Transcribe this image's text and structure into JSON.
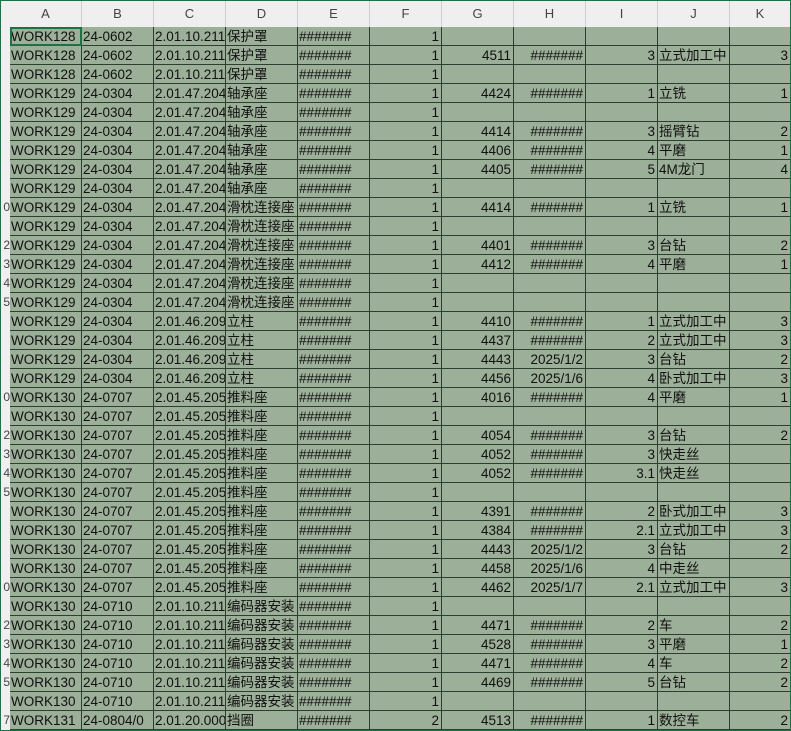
{
  "columns": [
    "A",
    "B",
    "C",
    "D",
    "E",
    "F",
    "G",
    "H",
    "I",
    "J",
    "K"
  ],
  "row_numbers": [
    "",
    "",
    "",
    "",
    "",
    "",
    "",
    "",
    "",
    "0",
    "",
    "2",
    "3",
    "4",
    "5",
    "",
    "",
    "",
    "",
    "0",
    "",
    "2",
    "3",
    "4",
    "5",
    "",
    "",
    "",
    "",
    "0",
    "",
    "2",
    "3",
    "4",
    "5",
    "",
    "7"
  ],
  "rows": [
    [
      "WORK128",
      "24-0602",
      "2.01.10.211",
      "保护罩",
      "#######",
      "1",
      "",
      "",
      "",
      "",
      ""
    ],
    [
      "WORK128",
      "24-0602",
      "2.01.10.211",
      "保护罩",
      "#######",
      "1",
      "4511",
      "#######",
      "3",
      "立式加工中",
      "3"
    ],
    [
      "WORK128",
      "24-0602",
      "2.01.10.211",
      "保护罩",
      "#######",
      "1",
      "",
      "",
      "",
      "",
      ""
    ],
    [
      "WORK129",
      "24-0304",
      "2.01.47.204",
      "轴承座",
      "#######",
      "1",
      "4424",
      "#######",
      "1",
      "立铣",
      "1"
    ],
    [
      "WORK129",
      "24-0304",
      "2.01.47.204",
      "轴承座",
      "#######",
      "1",
      "",
      "",
      "",
      "",
      ""
    ],
    [
      "WORK129",
      "24-0304",
      "2.01.47.204",
      "轴承座",
      "#######",
      "1",
      "4414",
      "#######",
      "3",
      "摇臂钻",
      "2"
    ],
    [
      "WORK129",
      "24-0304",
      "2.01.47.204",
      "轴承座",
      "#######",
      "1",
      "4406",
      "#######",
      "4",
      "平磨",
      "1"
    ],
    [
      "WORK129",
      "24-0304",
      "2.01.47.204",
      "轴承座",
      "#######",
      "1",
      "4405",
      "#######",
      "5",
      "4M龙门",
      "4"
    ],
    [
      "WORK129",
      "24-0304",
      "2.01.47.204",
      "轴承座",
      "#######",
      "1",
      "",
      "",
      "",
      "",
      ""
    ],
    [
      "WORK129",
      "24-0304",
      "2.01.47.204",
      "滑枕连接座",
      "#######",
      "1",
      "4414",
      "#######",
      "1",
      "立铣",
      "1"
    ],
    [
      "WORK129",
      "24-0304",
      "2.01.47.204",
      "滑枕连接座",
      "#######",
      "1",
      "",
      "",
      "",
      "",
      ""
    ],
    [
      "WORK129",
      "24-0304",
      "2.01.47.204",
      "滑枕连接座",
      "#######",
      "1",
      "4401",
      "#######",
      "3",
      "台钻",
      "2"
    ],
    [
      "WORK129",
      "24-0304",
      "2.01.47.204",
      "滑枕连接座",
      "#######",
      "1",
      "4412",
      "#######",
      "4",
      "平磨",
      "1"
    ],
    [
      "WORK129",
      "24-0304",
      "2.01.47.204",
      "滑枕连接座",
      "#######",
      "1",
      "",
      "",
      "",
      "",
      ""
    ],
    [
      "WORK129",
      "24-0304",
      "2.01.47.204",
      "滑枕连接座",
      "#######",
      "1",
      "",
      "",
      "",
      "",
      ""
    ],
    [
      "WORK129",
      "24-0304",
      "2.01.46.209",
      "立柱",
      "#######",
      "1",
      "4410",
      "#######",
      "1",
      "立式加工中",
      "3"
    ],
    [
      "WORK129",
      "24-0304",
      "2.01.46.209",
      "立柱",
      "#######",
      "1",
      "4437",
      "#######",
      "2",
      "立式加工中",
      "3"
    ],
    [
      "WORK129",
      "24-0304",
      "2.01.46.209",
      "立柱",
      "#######",
      "1",
      "4443",
      "2025/1/2",
      "3",
      "台钻",
      "2"
    ],
    [
      "WORK129",
      "24-0304",
      "2.01.46.209",
      "立柱",
      "#######",
      "1",
      "4456",
      "2025/1/6",
      "4",
      "卧式加工中",
      "3"
    ],
    [
      "WORK130",
      "24-0707",
      "2.01.45.205",
      "推料座",
      "#######",
      "1",
      "4016",
      "#######",
      "4",
      "平磨",
      "1"
    ],
    [
      "WORK130",
      "24-0707",
      "2.01.45.205",
      "推料座",
      "#######",
      "1",
      "",
      "",
      "",
      "",
      ""
    ],
    [
      "WORK130",
      "24-0707",
      "2.01.45.205",
      "推料座",
      "#######",
      "1",
      "4054",
      "#######",
      "3",
      "台钻",
      "2"
    ],
    [
      "WORK130",
      "24-0707",
      "2.01.45.205",
      "推料座",
      "#######",
      "1",
      "4052",
      "#######",
      "3",
      "快走丝",
      ""
    ],
    [
      "WORK130",
      "24-0707",
      "2.01.45.205",
      "推料座",
      "#######",
      "1",
      "4052",
      "#######",
      "3.1",
      "快走丝",
      ""
    ],
    [
      "WORK130",
      "24-0707",
      "2.01.45.205",
      "推料座",
      "#######",
      "1",
      "",
      "",
      "",
      "",
      ""
    ],
    [
      "WORK130",
      "24-0707",
      "2.01.45.205",
      "推料座",
      "#######",
      "1",
      "4391",
      "#######",
      "2",
      "卧式加工中",
      "3"
    ],
    [
      "WORK130",
      "24-0707",
      "2.01.45.205",
      "推料座",
      "#######",
      "1",
      "4384",
      "#######",
      "2.1",
      "立式加工中",
      "3"
    ],
    [
      "WORK130",
      "24-0707",
      "2.01.45.205",
      "推料座",
      "#######",
      "1",
      "4443",
      "2025/1/2",
      "3",
      "台钻",
      "2"
    ],
    [
      "WORK130",
      "24-0707",
      "2.01.45.205",
      "推料座",
      "#######",
      "1",
      "4458",
      "2025/1/6",
      "4",
      "中走丝",
      ""
    ],
    [
      "WORK130",
      "24-0707",
      "2.01.45.205",
      "推料座",
      "#######",
      "1",
      "4462",
      "2025/1/7",
      "2.1",
      "立式加工中",
      "3"
    ],
    [
      "WORK130",
      "24-0710",
      "2.01.10.211",
      "编码器安装",
      "#######",
      "1",
      "",
      "",
      "",
      "",
      ""
    ],
    [
      "WORK130",
      "24-0710",
      "2.01.10.211",
      "编码器安装",
      "#######",
      "1",
      "4471",
      "#######",
      "2",
      "车",
      "2"
    ],
    [
      "WORK130",
      "24-0710",
      "2.01.10.211",
      "编码器安装",
      "#######",
      "1",
      "4528",
      "#######",
      "3",
      "平磨",
      "1"
    ],
    [
      "WORK130",
      "24-0710",
      "2.01.10.211",
      "编码器安装",
      "#######",
      "1",
      "4471",
      "#######",
      "4",
      "车",
      "2"
    ],
    [
      "WORK130",
      "24-0710",
      "2.01.10.211",
      "编码器安装",
      "#######",
      "1",
      "4469",
      "#######",
      "5",
      "台钻",
      "2"
    ],
    [
      "WORK130",
      "24-0710",
      "2.01.10.211",
      "编码器安装",
      "#######",
      "1",
      "",
      "",
      "",
      "",
      ""
    ],
    [
      "WORK131",
      "24-0804/0",
      "2.01.20.000",
      "挡圈",
      "#######",
      "2",
      "4513",
      "#######",
      "1",
      "数控车",
      "2"
    ]
  ],
  "colors": {
    "cell_bg": "#9caf98",
    "header_bg": "#efefef",
    "selection": "#1e7145"
  }
}
